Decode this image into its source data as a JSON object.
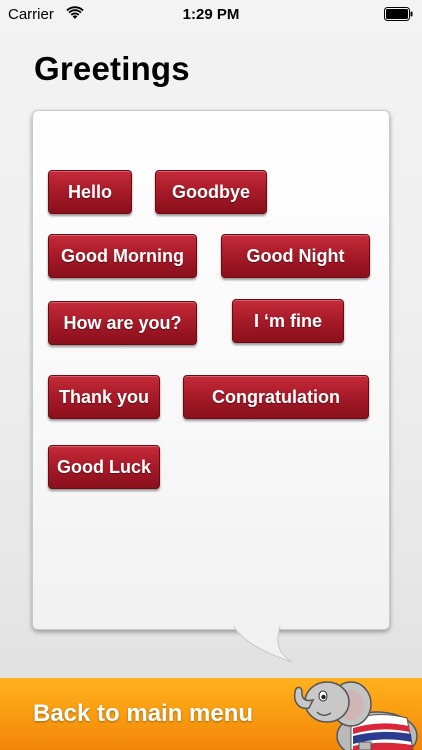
{
  "status_bar": {
    "carrier": "Carrier",
    "time": "1:29 PM"
  },
  "page": {
    "title": "Greetings"
  },
  "phrases": [
    {
      "id": "hello",
      "label": "Hello"
    },
    {
      "id": "goodbye",
      "label": "Goodbye"
    },
    {
      "id": "good-morning",
      "label": "Good Morning"
    },
    {
      "id": "good-night",
      "label": "Good Night"
    },
    {
      "id": "how-are-you",
      "label": "How are you?"
    },
    {
      "id": "im-fine",
      "label": "I ‘m fine"
    },
    {
      "id": "thank-you",
      "label": "Thank you"
    },
    {
      "id": "congratulation",
      "label": "Congratulation"
    },
    {
      "id": "good-luck",
      "label": "Good Luck"
    }
  ],
  "bottom_bar": {
    "back_label": "Back to main menu",
    "mascot": "elephant-icon"
  },
  "colors": {
    "button": "#a61a28",
    "bottom_bar": "#f99a10"
  }
}
